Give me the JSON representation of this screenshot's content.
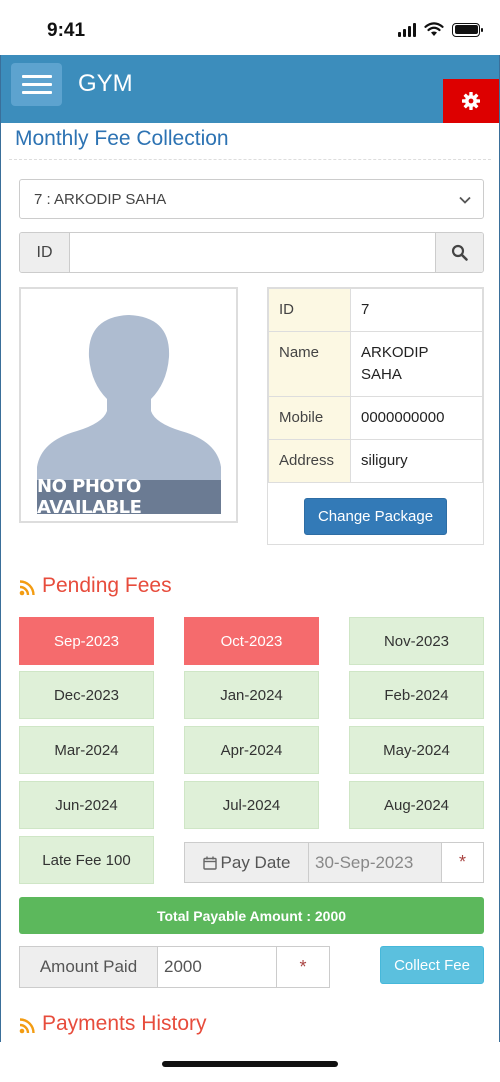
{
  "status_bar": {
    "time": "9:41"
  },
  "header": {
    "brand": "GYM",
    "menu_icon": "hamburger-menu-icon",
    "settings_icon": "gear-icon",
    "settings_color": "#dd0000",
    "bar_color": "#3c8dbc"
  },
  "page": {
    "title": "Monthly Fee Collection"
  },
  "member_select": {
    "selected": "7 : ARKODIP SAHA"
  },
  "id_search": {
    "label": "ID",
    "value": "",
    "icon": "search-icon"
  },
  "photo": {
    "placeholder_text": "NO PHOTO AVAILABLE"
  },
  "member_info": {
    "rows": [
      {
        "label": "ID",
        "value": "7"
      },
      {
        "label": "Name",
        "value": "ARKODIP SAHA"
      },
      {
        "label": "Mobile",
        "value": "0000000000"
      },
      {
        "label": "Address",
        "value": "siligury"
      }
    ],
    "change_package_label": "Change Package"
  },
  "pending_fees": {
    "heading": "Pending Fees",
    "icon": "rss-icon",
    "months": [
      {
        "label": "Sep-2023",
        "due": true
      },
      {
        "label": "Oct-2023",
        "due": true
      },
      {
        "label": "Nov-2023",
        "due": false
      },
      {
        "label": "Dec-2023",
        "due": false
      },
      {
        "label": "Jan-2024",
        "due": false
      },
      {
        "label": "Feb-2024",
        "due": false
      },
      {
        "label": "Mar-2024",
        "due": false
      },
      {
        "label": "Apr-2024",
        "due": false
      },
      {
        "label": "May-2024",
        "due": false
      },
      {
        "label": "Jun-2024",
        "due": false
      },
      {
        "label": "Jul-2024",
        "due": false
      },
      {
        "label": "Aug-2024",
        "due": false
      }
    ],
    "late_fee": "Late Fee 100"
  },
  "payment": {
    "pay_date_label": "Pay Date",
    "pay_date_icon": "calendar-icon",
    "pay_date_value": "30-Sep-2023",
    "required_mark": "*",
    "total_payable": "Total Payable Amount : 2000",
    "amount_paid_label": "Amount Paid",
    "amount_paid_value": "2000",
    "collect_label": "Collect Fee"
  },
  "payments_history": {
    "heading": "Payments History",
    "icon": "rss-icon"
  },
  "colors": {
    "due": "#f56b6d",
    "paid": "#dff0d8",
    "accent": "#e74c3c",
    "title": "#2d73b3",
    "success": "#5cb85c",
    "info": "#5bc0de",
    "primary": "#337ab7"
  }
}
